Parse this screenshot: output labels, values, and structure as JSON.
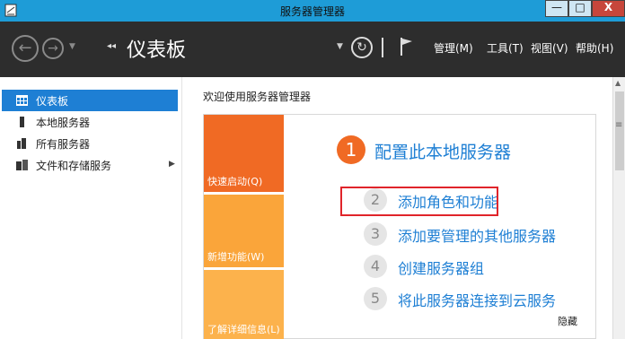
{
  "window": {
    "title": "服务器管理器",
    "minimize_glyph": "—",
    "maximize_glyph": "□",
    "close_glyph": "X",
    "accent_color": "#1e9cd7",
    "close_color": "#c7463b"
  },
  "toolbar": {
    "back_glyph": "←",
    "forward_glyph": "→",
    "dropdown_glyph": "▼",
    "crumb_chevron": "◂◂",
    "page_title": "仪表板",
    "refresh_glyph": "↻",
    "menus": [
      {
        "label": "管理(M)"
      },
      {
        "label": "工具(T)"
      },
      {
        "label": "视图(V)"
      },
      {
        "label": "帮助(H)"
      }
    ]
  },
  "sidebar": {
    "items": [
      {
        "label": "仪表板",
        "icon": "dashboard-icon",
        "active": true
      },
      {
        "label": "本地服务器",
        "icon": "server-icon"
      },
      {
        "label": "所有服务器",
        "icon": "servers-icon"
      },
      {
        "label": "文件和存储服务",
        "icon": "storage-icon",
        "has_children": true,
        "arrow": "▶"
      }
    ],
    "active_color": "#1e7fd4"
  },
  "main": {
    "welcome": "欢迎使用服务器管理器",
    "tiles": [
      {
        "label": "快速启动(Q)",
        "color": "#f06a24"
      },
      {
        "label": "新增功能(W)",
        "color": "#faa53a"
      },
      {
        "label": "了解详细信息(L)",
        "color": "#fcb24c"
      }
    ],
    "primary_step": {
      "number": "1",
      "label": "配置此本地服务器"
    },
    "steps": [
      {
        "number": "2",
        "label": "添加角色和功能"
      },
      {
        "number": "3",
        "label": "添加要管理的其他服务器"
      },
      {
        "number": "4",
        "label": "创建服务器组"
      },
      {
        "number": "5",
        "label": "将此服务器连接到云服务"
      }
    ],
    "hide_label": "隐藏",
    "highlight_color": "#e0242a"
  },
  "scrollbar": {
    "up_glyph": "▲",
    "menu_glyph": "≡"
  }
}
